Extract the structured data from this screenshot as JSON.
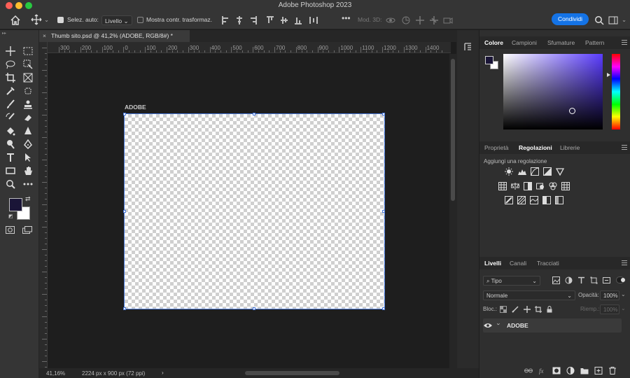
{
  "window": {
    "title": "Adobe Photoshop 2023"
  },
  "options_bar": {
    "auto_select_label": "Selez. auto:",
    "auto_select_value": "Livello",
    "show_transform_label": "Mostra contr. trasformaz.",
    "mode_3d_label": "Mod. 3D:",
    "share_label": "Condividi",
    "auto_select_checked": true,
    "show_transform_checked": false
  },
  "document": {
    "tab_title": "Thumb sito.psd @ 41,2% (ADOBE, RGB/8#) *",
    "close_glyph": "×",
    "artboard_name": "ADOBE",
    "ruler_marks": [
      "300",
      "200",
      "100",
      "0",
      "100",
      "200",
      "300",
      "400",
      "500",
      "600",
      "700",
      "800",
      "900",
      "1000",
      "1100",
      "1200",
      "1300",
      "1400"
    ]
  },
  "status_bar": {
    "zoom": "41,16%",
    "doc_info": "2224 px x 900 px (72 ppi)",
    "arrow": "›"
  },
  "colors": {
    "foreground": "#1a1537",
    "background": "#ffffff",
    "accent": "#1473e6"
  },
  "color_panel": {
    "tabs": [
      "Colore",
      "Campioni",
      "Sfumature",
      "Pattern"
    ],
    "active": "Colore"
  },
  "adjust_panel": {
    "tabs": [
      "Proprietà",
      "Regolazioni",
      "Librerie"
    ],
    "active": "Regolazioni",
    "hint": "Aggiungi una regolazione"
  },
  "layers_panel": {
    "tabs": [
      "Livelli",
      "Canali",
      "Tracciati"
    ],
    "active": "Livelli",
    "filter_value": "Tipo",
    "blend_mode": "Normale",
    "opacity_label": "Opacità:",
    "opacity_value": "100%",
    "lock_label": "Bloc.:",
    "fill_label": "Riemp.:",
    "fill_value": "100%",
    "layers": [
      {
        "name": "ADOBE",
        "visible": true,
        "expand_glyph": "›"
      }
    ]
  },
  "toolbar": {
    "tools": [
      "move-tool",
      "marquee-tool",
      "lasso-tool",
      "object-select-tool",
      "crop-tool",
      "frame-tool",
      "eyedropper-tool",
      "spot-heal-tool",
      "brush-tool",
      "stamp-tool",
      "history-brush-tool",
      "eraser-tool",
      "paint-bucket-tool",
      "sharpen-tool",
      "dodge-tool",
      "pen-tool",
      "type-tool",
      "path-select-tool",
      "rectangle-tool",
      "hand-tool",
      "zoom-tool",
      "more-tools"
    ]
  }
}
